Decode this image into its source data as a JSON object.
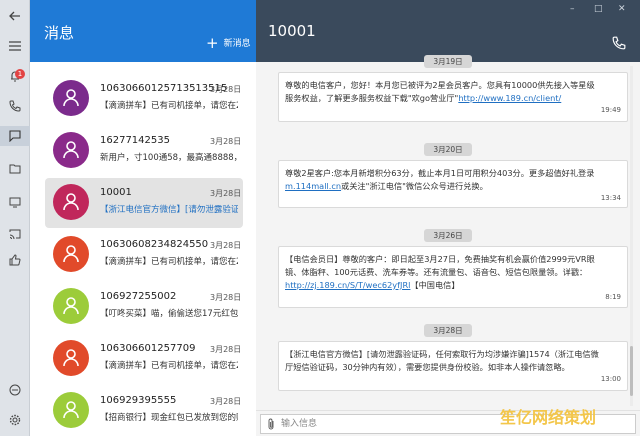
{
  "rail": {
    "icons": [
      "menu-icon",
      "notification-bell-icon",
      "phone-icon",
      "chat-icon",
      "folder-icon",
      "screen-icon",
      "thumbs-up-icon",
      "minus-circle-icon",
      "settings-icon"
    ],
    "badge_count": "1"
  },
  "list": {
    "title": "消息",
    "new_label": "新消息",
    "conversations": [
      {
        "name": "10630660125713513515",
        "date": "3月28日",
        "preview": "【滴滴拼车】已有司机接单，请您在20:",
        "avatar_color": "#7b2b8c",
        "selected": false
      },
      {
        "name": "16277142535",
        "date": "3月28日",
        "preview": "新用户，寸100通58，最高通8888，戳",
        "avatar_color": "#8a2a8a",
        "selected": false
      },
      {
        "name": "10001",
        "date": "3月28日",
        "preview": "【浙江电信官方微信】[请勿泄露验证码",
        "avatar_color": "#c0275b",
        "selected": true
      },
      {
        "name": "1063060823482455​0",
        "date": "3月28日",
        "preview": "【滴滴拼车】已有司机接单，请您在20:",
        "avatar_color": "#e14a2a",
        "selected": false
      },
      {
        "name": "106927255002",
        "date": "3月28日",
        "preview": "【叮咚买菜】喵，偷偷送您17元红包！",
        "avatar_color": "#9ccc3a",
        "selected": false
      },
      {
        "name": "106306601257709",
        "date": "3月28日",
        "preview": "【滴滴拼车】已有司机接单，请您在20:",
        "avatar_color": "#e14a2a",
        "selected": false
      },
      {
        "name": "106929395555",
        "date": "3月28日",
        "preview": "【招商银行】现金红包已发放到您的账户",
        "avatar_color": "#9ccc3a",
        "selected": false
      }
    ]
  },
  "chat": {
    "title": "10001",
    "window_controls": [
      "–",
      "□",
      "✕"
    ],
    "messages": [
      {
        "date": "3月19日",
        "text": "尊敬的电信客户，您好！本月您已被评为2星会员客户。您具有10000供先接入等星级服务权益，了解更多服务权益下载\"欢go营业厅\"",
        "link": "http://www.189.cn/client/",
        "time": "19:49"
      },
      {
        "date": "3月20日",
        "text": "尊敬2星客户:您本月新增积分63分，截止本月1日可用积分403分。更多超值好礼登录",
        "link": "m.114mall.cn",
        "text2": "或关注\"浙江电信\"微信公众号进行兑换。",
        "time": "13:34"
      },
      {
        "date": "3月26日",
        "text": "【电信会员日】尊敬的客户：即日起至3月27日，免费抽奖有机会赢价值2999元VR眼镜、体脂秤、100元话费、洗车券等。还有流量包、语音包、短信包限量领。详戳：",
        "link": "http://zj.189.cn/S/T/wec62yfJRl",
        "text2": "【中国电信】",
        "time": "8:19"
      },
      {
        "date": "3月28日",
        "text": "【浙江电信官方微信】[请勿泄露验证码，任何索取行为均涉嫌诈骗]1574（浙江电信微厅短信验证码，30分钟内有效），需要您提供身份校验。如非本人操作请忽略。",
        "time": "13:00"
      }
    ],
    "input_placeholder": "输入信息"
  },
  "watermark": "笙亿网络策划"
}
